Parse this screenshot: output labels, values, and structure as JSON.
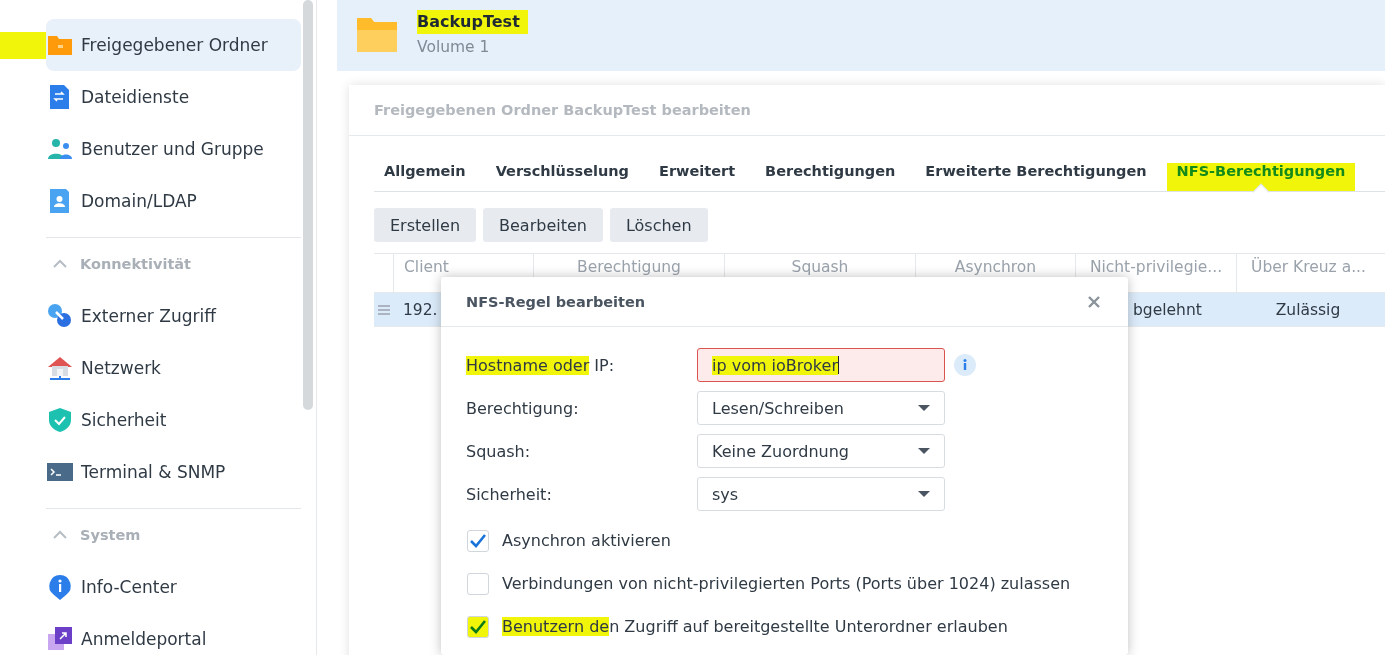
{
  "sidebar": {
    "sections": [
      {
        "items": [
          {
            "label": "Freigegebener Ordner",
            "kind": "shared-folder",
            "selected": true,
            "highlighted": true
          },
          {
            "label": "Dateidienste",
            "kind": "file-services",
            "selected": false,
            "highlighted": false
          },
          {
            "label": "Benutzer und Gruppe",
            "kind": "users",
            "selected": false,
            "highlighted": false
          },
          {
            "label": "Domain/LDAP",
            "kind": "domain",
            "selected": false,
            "highlighted": false
          }
        ]
      },
      {
        "title": "Konnektivität",
        "expanded": true,
        "items": [
          {
            "label": "Externer Zugriff",
            "kind": "external",
            "selected": false,
            "highlighted": false
          },
          {
            "label": "Netzwerk",
            "kind": "network",
            "selected": false,
            "highlighted": false
          },
          {
            "label": "Sicherheit",
            "kind": "security",
            "selected": false,
            "highlighted": false
          },
          {
            "label": "Terminal & SNMP",
            "kind": "terminal",
            "selected": false,
            "highlighted": false
          }
        ]
      },
      {
        "title": "System",
        "expanded": true,
        "items": [
          {
            "label": "Info-Center",
            "kind": "info",
            "selected": false,
            "highlighted": false
          },
          {
            "label": "Anmeldeportal",
            "kind": "portal",
            "selected": false,
            "highlighted": false
          }
        ]
      }
    ]
  },
  "header": {
    "name": "BackupTest",
    "highlighted": true,
    "subtitle": "Volume 1"
  },
  "editor": {
    "title": "Freigegebenen Ordner BackupTest bearbeiten",
    "tabs": [
      {
        "label": "Allgemein",
        "selected": false,
        "highlighted": false
      },
      {
        "label": "Verschlüsselung",
        "selected": false,
        "highlighted": false
      },
      {
        "label": "Erweitert",
        "selected": false,
        "highlighted": false
      },
      {
        "label": "Berechtigungen",
        "selected": false,
        "highlighted": false
      },
      {
        "label": "Erweiterte Berechtigungen",
        "selected": false,
        "highlighted": false
      },
      {
        "label": "NFS-Berechtigungen",
        "selected": true,
        "highlighted": true
      }
    ],
    "buttons": [
      "Erstellen",
      "Bearbeiten",
      "Löschen"
    ],
    "table": {
      "columns": [
        "Client",
        "Berechtigung",
        "Squash",
        "Asynchron",
        "Nicht-privilegie...",
        "Über Kreuz a..."
      ],
      "rows": [
        {
          "selected": true,
          "cells": [
            "192.",
            null,
            null,
            null,
            "bgelehnt",
            "Zulässig"
          ]
        }
      ]
    }
  },
  "dialog": {
    "title": "NFS-Regel bearbeiten",
    "fields": [
      {
        "kind": "text",
        "label": [
          {
            "text": "Hostname oder",
            "highlighted": true
          },
          {
            "text": " IP:",
            "highlighted": false
          }
        ],
        "value": "ip vom ioBroker",
        "highlighted": true,
        "invalid": true,
        "info": true
      },
      {
        "kind": "select",
        "label": [
          {
            "text": "Berechtigung:",
            "highlighted": false
          }
        ],
        "value": "Lesen/Schreiben"
      },
      {
        "kind": "select",
        "label": [
          {
            "text": "Squash:",
            "highlighted": false
          }
        ],
        "value": "Keine Zuordnung"
      },
      {
        "kind": "select",
        "label": [
          {
            "text": "Sicherheit:",
            "highlighted": false
          }
        ],
        "value": "sys"
      }
    ],
    "checkboxes": [
      {
        "label": [
          {
            "text": "Asynchron aktivieren",
            "highlighted": false
          }
        ],
        "checked": true,
        "highlighted": false
      },
      {
        "label": [
          {
            "text": "Verbindungen von nicht-privilegierten Ports (Ports über 1024) zulassen",
            "highlighted": false
          }
        ],
        "checked": false,
        "highlighted": false
      },
      {
        "label": [
          {
            "text": "Benutzern de",
            "highlighted": true
          },
          {
            "text": "n Zugriff auf bereitgestellte Unterordner erlauben",
            "highlighted": false
          }
        ],
        "checked": true,
        "highlighted": true
      }
    ]
  }
}
